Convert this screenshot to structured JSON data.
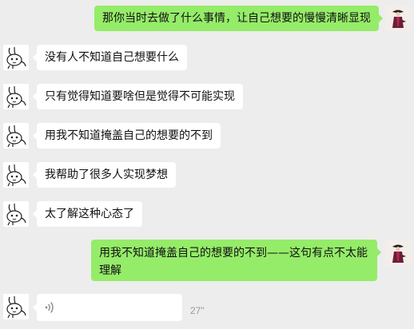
{
  "messages": [
    {
      "from": "me",
      "text": "那你当时去做了什么事情，让自己想要的慢慢清晰显现"
    },
    {
      "from": "friend",
      "text": "没有人不知道自己想要什么"
    },
    {
      "from": "friend",
      "text": "只有觉得知道要啥但是觉得不可能实现"
    },
    {
      "from": "friend",
      "text": "用我不知道掩盖自己的想要的不到"
    },
    {
      "from": "friend",
      "text": "我帮助了很多人实现梦想"
    },
    {
      "from": "friend",
      "text": "太了解这种心态了"
    },
    {
      "from": "me",
      "text": "用我不知道掩盖自己的想要的不到——这句有点不太能理解"
    }
  ],
  "voice_message": {
    "from": "friend",
    "duration": "27\"",
    "icon": "voice-wave-icon"
  },
  "avatars": {
    "friend": "rabbit-doodle-avatar",
    "me": "figure-painting-avatar"
  },
  "colors": {
    "background": "#ededed",
    "outgoing_bubble": "#95ec69",
    "incoming_bubble": "#ffffff",
    "text": "#111111",
    "duration": "#9a9a9a"
  }
}
